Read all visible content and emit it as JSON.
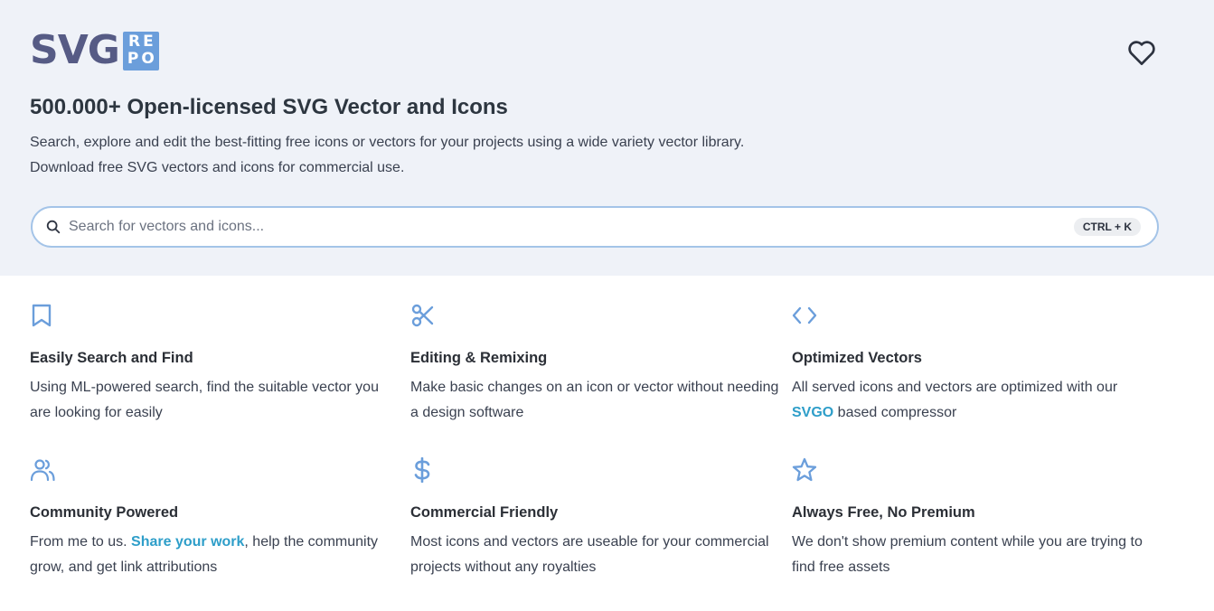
{
  "brand": {
    "logo_main": "SVG",
    "logo_box_top": "RE",
    "logo_box_bottom": "PO"
  },
  "colors": {
    "accent": "#6b9edb",
    "link": "#2e9ec9",
    "hero_bg": "#eff2f8",
    "logo_text": "#565b85"
  },
  "header": {
    "favorites_icon": "heart-icon"
  },
  "hero": {
    "title": "500.000+ Open-licensed SVG Vector and Icons",
    "subtitle_1": "Search, explore and edit the best-fitting free icons or vectors for your projects using a wide variety vector library.",
    "subtitle_2": "Download free SVG vectors and icons for commercial use."
  },
  "search": {
    "placeholder": "Search for vectors and icons...",
    "value": "",
    "shortcut": "CTRL + K"
  },
  "features": [
    {
      "icon": "bookmark-icon",
      "title": "Easily Search and Find",
      "text": "Using ML-powered search, find the suitable vector you are looking for easily"
    },
    {
      "icon": "scissors-icon",
      "title": "Editing & Remixing",
      "text": "Make basic changes on an icon or vector without needing a design software"
    },
    {
      "icon": "code-icon",
      "title": "Optimized Vectors",
      "text_before": "All served icons and vectors are optimized with our ",
      "link": "SVGO",
      "text_after": " based compressor"
    },
    {
      "icon": "users-icon",
      "title": "Community Powered",
      "text_before": "From me to us. ",
      "link": "Share your work",
      "text_after": ", help the community grow, and get link attributions"
    },
    {
      "icon": "dollar-icon",
      "title": "Commercial Friendly",
      "text": "Most icons and vectors are useable for your commercial projects without any royalties"
    },
    {
      "icon": "star-icon",
      "title": "Always Free, No Premium",
      "text": "We don't show premium content while you are trying to find free assets"
    }
  ]
}
